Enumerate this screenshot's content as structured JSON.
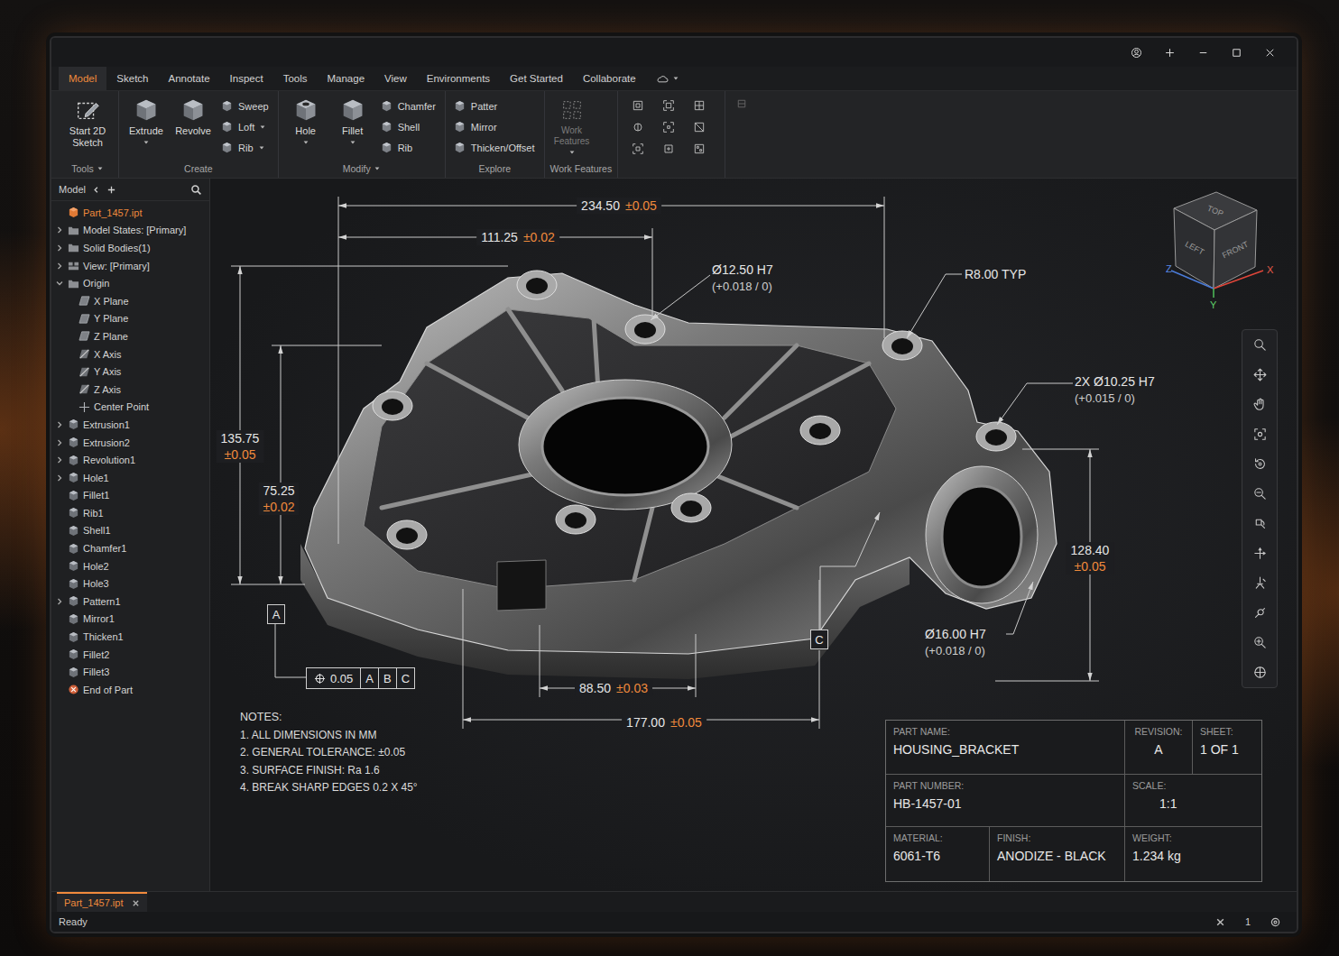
{
  "tabs": [
    {
      "label": "Model",
      "selected": true
    },
    {
      "label": "Sketch",
      "selected": false
    },
    {
      "label": "Annotate",
      "selected": false
    },
    {
      "label": "Inspect",
      "selected": false
    },
    {
      "label": "Tools",
      "selected": false
    },
    {
      "label": "Manage",
      "selected": false
    },
    {
      "label": "View",
      "selected": false
    },
    {
      "label": "Environments",
      "selected": false
    },
    {
      "label": "Get Started",
      "selected": false
    },
    {
      "label": "Collaborate",
      "selected": false
    }
  ],
  "ribbon": {
    "groups": [
      {
        "label": "Tools",
        "dropdown": true,
        "large": [
          {
            "label": "Start 2D Sketch",
            "dropdown": false,
            "disabled": false
          }
        ],
        "small": []
      },
      {
        "label": "Create",
        "dropdown": false,
        "large": [
          {
            "label": "Extrude",
            "dropdown": true,
            "disabled": false
          },
          {
            "label": "Revolve",
            "dropdown": false,
            "disabled": false
          }
        ],
        "small": [
          {
            "label": "Sweep",
            "dropdown": false
          },
          {
            "label": "Loft",
            "dropdown": true
          },
          {
            "label": "Rib",
            "dropdown": true
          }
        ]
      },
      {
        "label": "Modify",
        "dropdown": true,
        "large": [
          {
            "label": "Hole",
            "dropdown": true,
            "disabled": false
          },
          {
            "label": "Fillet",
            "dropdown": true,
            "disabled": false
          }
        ],
        "small": [
          {
            "label": "Chamfer",
            "dropdown": false
          },
          {
            "label": "Shell",
            "dropdown": false
          },
          {
            "label": "Rib",
            "dropdown": false
          }
        ]
      },
      {
        "label": "Explore",
        "dropdown": false,
        "large": [],
        "small": [
          {
            "label": "Patter",
            "dropdown": false
          },
          {
            "label": "Mirror",
            "dropdown": false
          },
          {
            "label": "Thicken/Offset",
            "dropdown": false
          }
        ]
      },
      {
        "label": "Work Features",
        "dropdown": false,
        "large": [
          {
            "label": "Work Features",
            "dropdown": true,
            "disabled": true
          }
        ],
        "small": []
      }
    ]
  },
  "browser": {
    "header": "Model",
    "items": [
      {
        "label": "Part_1457.ipt",
        "kind": "part",
        "level": 0,
        "expandable": false,
        "expanded": false,
        "selected": true
      },
      {
        "label": "Model States: [Primary]",
        "kind": "folder",
        "level": 0,
        "expandable": true,
        "expanded": false,
        "selected": false
      },
      {
        "label": "Solid Bodies(1)",
        "kind": "folder",
        "level": 0,
        "expandable": true,
        "expanded": false,
        "selected": false
      },
      {
        "label": "View: [Primary]",
        "kind": "view",
        "level": 0,
        "expandable": true,
        "expanded": false,
        "selected": false
      },
      {
        "label": "Origin",
        "kind": "folder",
        "level": 0,
        "expandable": true,
        "expanded": true,
        "selected": false
      },
      {
        "label": "X Plane",
        "kind": "plane",
        "level": 1,
        "expandable": false,
        "expanded": false,
        "selected": false
      },
      {
        "label": "Y Plane",
        "kind": "plane",
        "level": 1,
        "expandable": false,
        "expanded": false,
        "selected": false
      },
      {
        "label": "Z Plane",
        "kind": "plane",
        "level": 1,
        "expandable": false,
        "expanded": false,
        "selected": false
      },
      {
        "label": "X Axis",
        "kind": "axis",
        "level": 1,
        "expandable": false,
        "expanded": false,
        "selected": false
      },
      {
        "label": "Y Axis",
        "kind": "axis",
        "level": 1,
        "expandable": false,
        "expanded": false,
        "selected": false
      },
      {
        "label": "Z Axis",
        "kind": "axis",
        "level": 1,
        "expandable": false,
        "expanded": false,
        "selected": false
      },
      {
        "label": "Center Point",
        "kind": "point",
        "level": 1,
        "expandable": false,
        "expanded": false,
        "selected": false
      },
      {
        "label": "Extrusion1",
        "kind": "feature",
        "level": 0,
        "expandable": true,
        "expanded": false,
        "selected": false
      },
      {
        "label": "Extrusion2",
        "kind": "feature",
        "level": 0,
        "expandable": true,
        "expanded": false,
        "selected": false
      },
      {
        "label": "Revolution1",
        "kind": "feature",
        "level": 0,
        "expandable": true,
        "expanded": false,
        "selected": false
      },
      {
        "label": "Hole1",
        "kind": "feature",
        "level": 0,
        "expandable": true,
        "expanded": false,
        "selected": false
      },
      {
        "label": "Fillet1",
        "kind": "feature",
        "level": 0,
        "expandable": false,
        "expanded": false,
        "selected": false
      },
      {
        "label": "Rib1",
        "kind": "feature",
        "level": 0,
        "expandable": false,
        "expanded": false,
        "selected": false
      },
      {
        "label": "Shell1",
        "kind": "feature",
        "level": 0,
        "expandable": false,
        "expanded": false,
        "selected": false
      },
      {
        "label": "Chamfer1",
        "kind": "feature",
        "level": 0,
        "expandable": false,
        "expanded": false,
        "selected": false
      },
      {
        "label": "Hole2",
        "kind": "feature",
        "level": 0,
        "expandable": false,
        "expanded": false,
        "selected": false
      },
      {
        "label": "Hole3",
        "kind": "feature",
        "level": 0,
        "expandable": false,
        "expanded": false,
        "selected": false
      },
      {
        "label": "Pattern1",
        "kind": "feature",
        "level": 0,
        "expandable": true,
        "expanded": false,
        "selected": false
      },
      {
        "label": "Mirror1",
        "kind": "feature",
        "level": 0,
        "expandable": false,
        "expanded": false,
        "selected": false
      },
      {
        "label": "Thicken1",
        "kind": "feature",
        "level": 0,
        "expandable": false,
        "expanded": false,
        "selected": false
      },
      {
        "label": "Fillet2",
        "kind": "feature",
        "level": 0,
        "expandable": false,
        "expanded": false,
        "selected": false
      },
      {
        "label": "Fillet3",
        "kind": "feature",
        "level": 0,
        "expandable": false,
        "expanded": false,
        "selected": false
      },
      {
        "label": "End of Part",
        "kind": "end",
        "level": 0,
        "expandable": false,
        "expanded": false,
        "selected": false
      }
    ]
  },
  "drawing": {
    "dimensions": [
      {
        "value": "234.50",
        "tolerance": "±0.05",
        "kind": "horizontal"
      },
      {
        "value": "111.25",
        "tolerance": "±0.02",
        "kind": "horizontal"
      },
      {
        "value": "135.75",
        "tolerance": "±0.05",
        "kind": "vertical"
      },
      {
        "value": "75.25",
        "tolerance": "±0.02",
        "kind": "vertical"
      },
      {
        "value": "128.40",
        "tolerance": "±0.05",
        "kind": "vertical"
      },
      {
        "value": "88.50",
        "tolerance": "±0.03",
        "kind": "horizontal"
      },
      {
        "value": "177.00",
        "tolerance": "±0.05",
        "kind": "horizontal"
      }
    ],
    "callouts": [
      {
        "lines": [
          "Ø12.50 H7",
          "(+0.018 / 0)"
        ]
      },
      {
        "lines": [
          "R8.00 TYP"
        ]
      },
      {
        "lines": [
          "2X Ø10.25 H7",
          "(+0.015 / 0)"
        ]
      },
      {
        "lines": [
          "Ø16.00 H7",
          "(+0.018 / 0)"
        ]
      }
    ],
    "datums": [
      "A",
      "C"
    ],
    "feature_control_frame": {
      "tolerance": "0.05",
      "datums": [
        "A",
        "B",
        "C"
      ]
    },
    "notes": {
      "title": "NOTES:",
      "lines": [
        "1. ALL DIMENSIONS IN MM",
        "2. GENERAL TOLERANCE: ±0.05",
        "3. SURFACE FINISH: Ra 1.6",
        "4. BREAK SHARP EDGES 0.2 X 45°"
      ]
    },
    "title_block": {
      "part_name": {
        "label": "PART NAME:",
        "value": "HOUSING_BRACKET"
      },
      "revision": {
        "label": "REVISION:",
        "value": "A"
      },
      "sheet": {
        "label": "SHEET:",
        "value": "1 OF 1"
      },
      "part_number": {
        "label": "PART NUMBER:",
        "value": "HB-1457-01"
      },
      "scale": {
        "label": "SCALE:",
        "value": "1:1"
      },
      "material": {
        "label": "MATERIAL:",
        "value": "6061-T6"
      },
      "finish": {
        "label": "FINISH:",
        "value": "ANODIZE - BLACK"
      },
      "weight": {
        "label": "WEIGHT:",
        "value": "1.234 kg"
      }
    },
    "view_cube": {
      "faces": [
        "TOP",
        "LEFT",
        "FRONT"
      ],
      "axes": [
        "Z",
        "X",
        "Y"
      ]
    }
  },
  "file_tabs": [
    {
      "label": "Part_1457.ipt",
      "selected": true
    }
  ],
  "status_bar": {
    "text": "Ready",
    "count": "1"
  }
}
